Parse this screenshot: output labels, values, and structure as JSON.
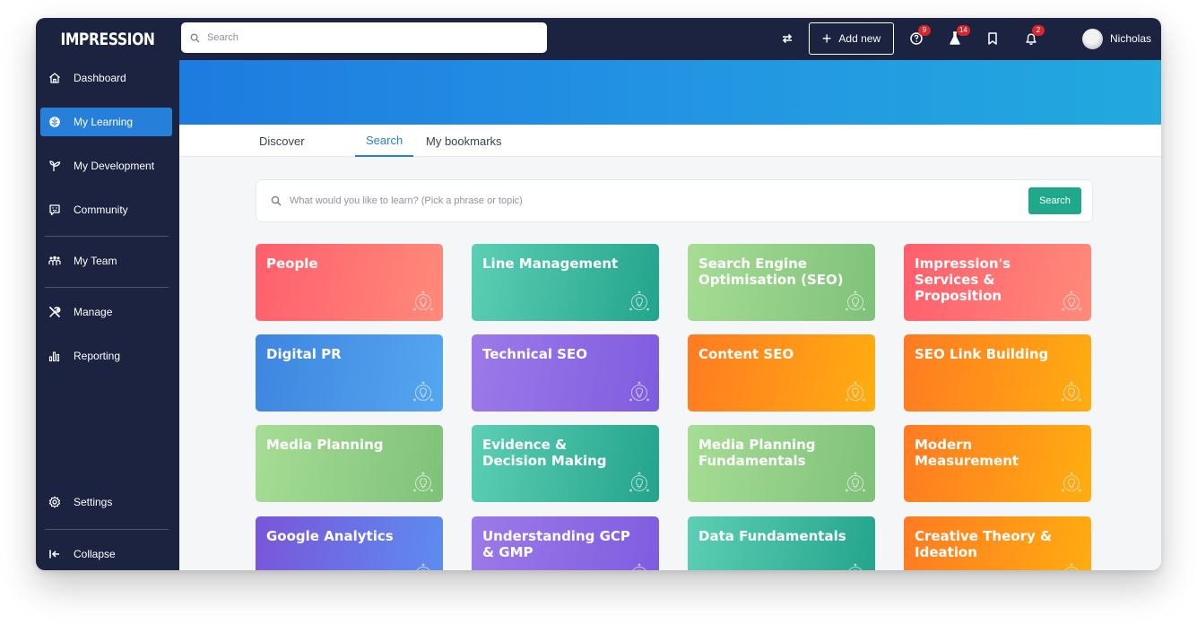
{
  "app": {
    "logo": "IMPRESSION"
  },
  "topbar": {
    "search_placeholder": "Search",
    "add_new_label": "Add new",
    "help_badge": "9",
    "lab_badge": "14",
    "notifications_badge": "2",
    "user_name": "Nicholas"
  },
  "sidebar": {
    "items": [
      {
        "label": "Dashboard",
        "icon": "home-icon"
      },
      {
        "label": "My Learning",
        "icon": "brain-icon",
        "active": true
      },
      {
        "label": "My Development",
        "icon": "sprout-icon"
      },
      {
        "label": "Community",
        "icon": "chat-smile-icon"
      },
      {
        "label": "My Team",
        "icon": "team-icon"
      },
      {
        "label": "Manage",
        "icon": "tools-icon"
      },
      {
        "label": "Reporting",
        "icon": "bar-chart-icon"
      },
      {
        "label": "Settings",
        "icon": "gear-icon"
      },
      {
        "label": "Collapse",
        "icon": "collapse-icon"
      }
    ]
  },
  "tabs": [
    {
      "label": "Discover"
    },
    {
      "label": "Search",
      "active": true
    },
    {
      "label": "My bookmarks"
    }
  ],
  "learn_search": {
    "placeholder": "What would you like to learn? (Pick a phrase or topic)",
    "button_label": "Search"
  },
  "topics": [
    {
      "title": "People",
      "colors": [
        "#ff5f6d",
        "#ff8a7a"
      ]
    },
    {
      "title": "Line Management",
      "colors": [
        "#5ccfb4",
        "#23a48c"
      ]
    },
    {
      "title": "Search Engine Optimisation (SEO)",
      "colors": [
        "#a7dd95",
        "#7fc17a"
      ]
    },
    {
      "title": "Impression's Services & Proposition",
      "colors": [
        "#ff5f6d",
        "#ff8a7a"
      ]
    },
    {
      "title": "Digital PR",
      "colors": [
        "#3e85e0",
        "#55a6f0"
      ]
    },
    {
      "title": "Technical SEO",
      "colors": [
        "#9d7ae8",
        "#7e5ce0"
      ]
    },
    {
      "title": "Content SEO",
      "colors": [
        "#ff7b22",
        "#ffad10"
      ]
    },
    {
      "title": "SEO Link Building",
      "colors": [
        "#ff7b22",
        "#ffad10"
      ]
    },
    {
      "title": "Media Planning",
      "colors": [
        "#a7dd95",
        "#7fc17a"
      ]
    },
    {
      "title": "Evidence & Decision Making",
      "colors": [
        "#5ccfb4",
        "#23a48c"
      ]
    },
    {
      "title": "Media Planning Fundamentals",
      "colors": [
        "#a7dd95",
        "#7fc17a"
      ]
    },
    {
      "title": "Modern Measurement",
      "colors": [
        "#ff7b22",
        "#ffad10"
      ]
    },
    {
      "title": "Google Analytics",
      "colors": [
        "#7a55d9",
        "#5c8ef0"
      ]
    },
    {
      "title": "Understanding GCP & GMP",
      "colors": [
        "#9d7ae8",
        "#7e5ce0"
      ]
    },
    {
      "title": "Data Fundamentals",
      "colors": [
        "#5ccfb4",
        "#23a48c"
      ]
    },
    {
      "title": "Creative Theory & Ideation",
      "colors": [
        "#ff7b22",
        "#ffad10"
      ]
    }
  ]
}
